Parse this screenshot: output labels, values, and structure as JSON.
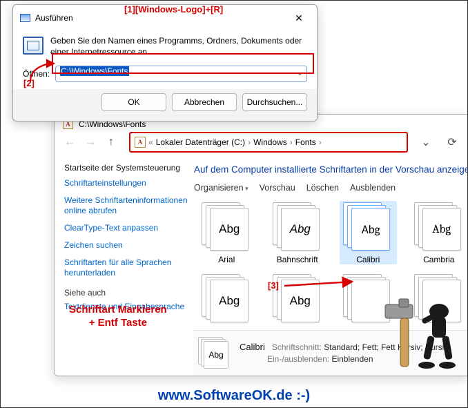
{
  "watermark": "SoftwareOK.de",
  "footer": "www.SoftwareOK.de :-)",
  "annotations": {
    "a1": "[1][Windows-Logo]+[R]",
    "a2": "[2]",
    "a3": "[3]",
    "hint_line1": "Schriftart Markieren",
    "hint_line2": "+ Entf Taste"
  },
  "run": {
    "title": "Ausführen",
    "bodytext": "Geben Sie den Namen eines Programms, Ordners, Dokuments oder einer Internetressource an.",
    "open_label": "Öffnen:",
    "input_value": "C:\\Windows\\Fonts",
    "ok": "OK",
    "cancel": "Abbrechen",
    "browse": "Durchsuchen..."
  },
  "explorer": {
    "title": "C:\\Windows\\Fonts",
    "bc_prefix": "«",
    "bc1": "Lokaler Datenträger (C:)",
    "bc2": "Windows",
    "bc3": "Fonts",
    "sidebar_head": "Startseite der Systemsteuerung",
    "links": [
      "Schriftarteinstellungen",
      "Weitere Schriftarteninformationen online abrufen",
      "ClearType-Text anpassen",
      "Zeichen suchen",
      "Schriftarten für alle Sprachen herunterladen"
    ],
    "see_also": "Siehe auch",
    "see_link": "Textdienste und Eingabesprache",
    "heading": "Auf dem Computer installierte Schriftarten in der Vorschau anzeigen, löschen oder ein- und ausblenden",
    "toolbar": {
      "org": "Organisieren",
      "preview": "Vorschau",
      "del": "Löschen",
      "hide": "Ausblenden"
    },
    "fonts_row1": [
      {
        "label": "Arial",
        "sample": "Abg",
        "family": "Arial, sans-serif"
      },
      {
        "label": "Bahnschrift",
        "sample": "Abg",
        "family": "Bahnschrift, sans-serif",
        "italic": true
      },
      {
        "label": "Calibri",
        "sample": "Abg",
        "family": "Calibri, sans-serif",
        "selected": true
      },
      {
        "label": "Cambria",
        "sample": "Abg",
        "family": "Cambria, serif"
      }
    ],
    "fonts_row2": [
      {
        "label": "",
        "sample": "Abg",
        "family": "Arial"
      },
      {
        "label": "",
        "sample": "Abg",
        "family": "Arial"
      },
      {
        "label": "",
        "sample": "",
        "family": "Arial"
      },
      {
        "label": "",
        "sample": "",
        "family": "Arial"
      }
    ],
    "detail": {
      "name": "Calibri",
      "cut_label": "Schriftschnitt:",
      "cut_value": "Standard; Fett; Fett Kursiv; Kursiv",
      "show_label": "Ein-/ausblenden:",
      "show_value": "Einblenden"
    }
  }
}
